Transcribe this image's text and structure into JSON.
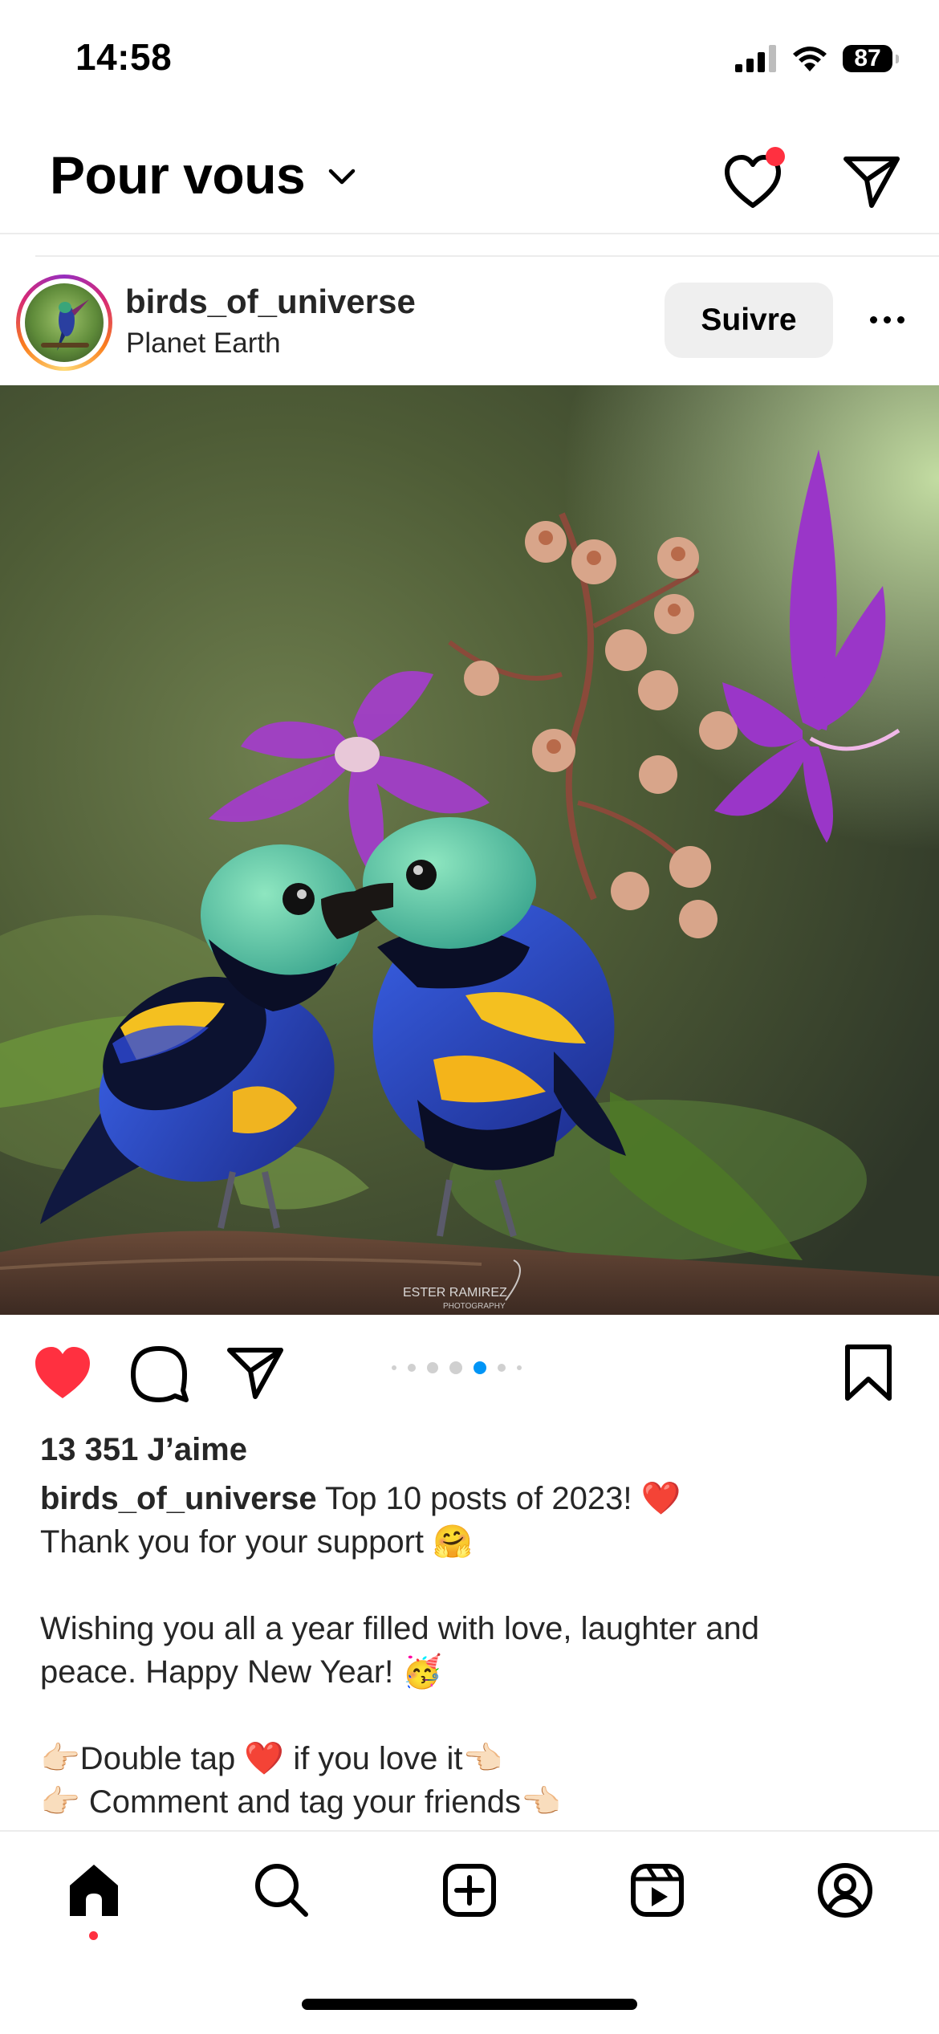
{
  "status_bar": {
    "time": "14:58",
    "battery": "87"
  },
  "header": {
    "title": "Pour vous"
  },
  "post": {
    "username": "birds_of_universe",
    "location": "Planet Earth",
    "follow_label": "Suivre",
    "photo_credit": "ESTER RAMIREZ",
    "photo_credit_sub": "PHOTOGRAPHY",
    "likes": "13 351 J’aime",
    "caption_username": "birds_of_universe",
    "caption_lines": [
      "Top 10 posts of 2023! ❤️",
      "Thank you for your support 🤗",
      "",
      "Wishing you all a year filled with love, laughter and",
      "peace. Happy New Year! 🥳",
      "",
      "👉🏻Double tap ❤️ if you love it👈🏻",
      "👉🏻 Comment and tag your friends👈🏻"
    ],
    "carousel": {
      "count": 7,
      "active_index": 4
    },
    "liked": true
  },
  "colors": {
    "like_red": "#ff3040",
    "carousel_active": "#0095f6"
  },
  "icons": [
    "signal-icon",
    "wifi-icon",
    "battery-icon",
    "chevron-down-icon",
    "heart-icon",
    "send-icon",
    "more-icon",
    "like-icon",
    "comment-icon",
    "share-icon",
    "bookmark-icon",
    "home-icon",
    "search-icon",
    "create-icon",
    "reels-icon",
    "profile-icon"
  ]
}
